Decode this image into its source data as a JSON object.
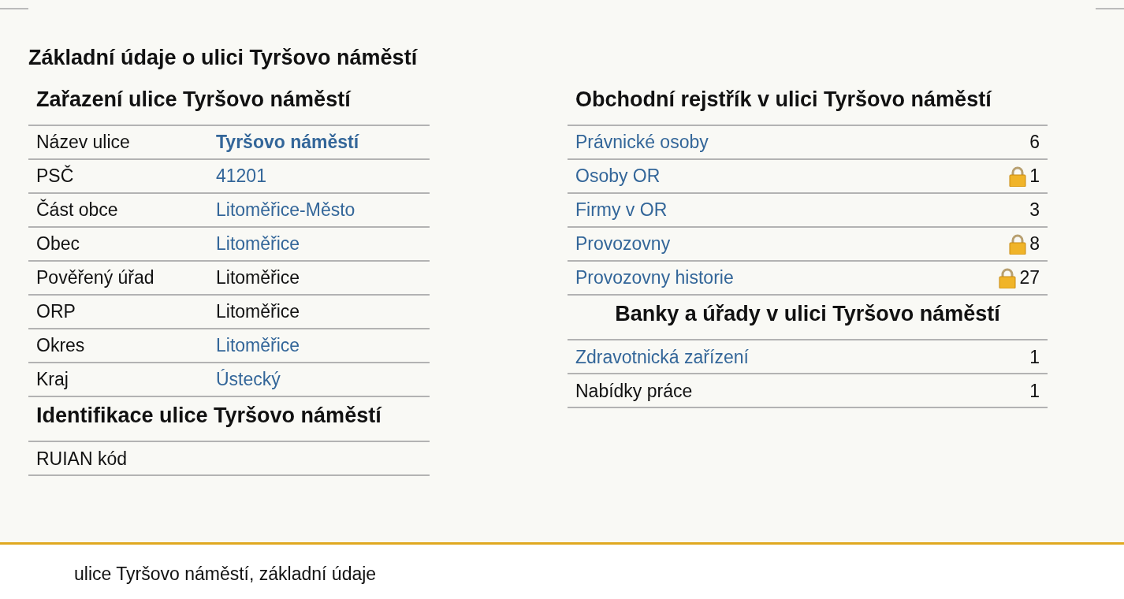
{
  "page_title": "Základní údaje o ulici Tyršovo náměstí",
  "left_sections": [
    {
      "title": "Zařazení ulice Tyršovo náměstí",
      "rows": [
        {
          "label": "Název ulice",
          "value": "Tyršovo náměstí",
          "link": true,
          "bold": true
        },
        {
          "label": "PSČ",
          "value": "41201",
          "link": true,
          "bold": false
        },
        {
          "label": "Část obce",
          "value": "Litoměřice-Město",
          "link": true,
          "bold": false
        },
        {
          "label": "Obec",
          "value": "Litoměřice",
          "link": true,
          "bold": false
        },
        {
          "label": "Pověřený úřad",
          "value": "Litoměřice",
          "link": false,
          "bold": false
        },
        {
          "label": "ORP",
          "value": "Litoměřice",
          "link": false,
          "bold": false
        },
        {
          "label": "Okres",
          "value": "Litoměřice",
          "link": true,
          "bold": false
        },
        {
          "label": "Kraj",
          "value": "Ústecký",
          "link": true,
          "bold": false
        }
      ]
    },
    {
      "title": "Identifikace ulice Tyršovo náměstí",
      "rows": [
        {
          "label": "RUIAN kód",
          "link": false,
          "bold": false
        }
      ]
    }
  ],
  "right_sections": [
    {
      "title": "Obchodní rejstřík v ulici Tyršovo náměstí",
      "centered": false,
      "rows": [
        {
          "label": "Právnické osoby",
          "count": "6",
          "link": true,
          "locked": false
        },
        {
          "label": "Osoby OR",
          "count": "1",
          "link": true,
          "locked": true
        },
        {
          "label": "Firmy v OR",
          "count": "3",
          "link": true,
          "locked": false
        },
        {
          "label": "Provozovny",
          "count": "8",
          "link": true,
          "locked": true
        },
        {
          "label": "Provozovny historie",
          "count": "27",
          "link": true,
          "locked": true
        }
      ]
    },
    {
      "title": "Banky a úřady v ulici Tyršovo náměstí",
      "centered": true,
      "rows": [
        {
          "label": "Zdravotnická zařízení",
          "count": "1",
          "link": true,
          "locked": false
        },
        {
          "label": "Nabídky práce",
          "count": "1",
          "link": false,
          "locked": false
        }
      ]
    }
  ],
  "footer": "ulice Tyršovo náměstí, základní údaje"
}
